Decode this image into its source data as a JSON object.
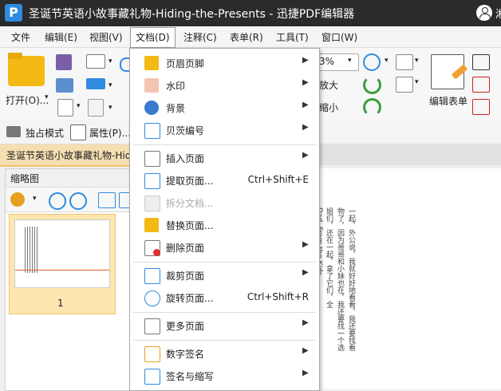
{
  "title_bar": {
    "logo_letter": "P",
    "title": "圣诞节英语小故事藏礼物-Hiding-the-Presents - 迅捷PDF编辑器",
    "user_glyph": "湘"
  },
  "menu": [
    "文件",
    "编辑(E)",
    "视图(V)",
    "文档(D)",
    "注释(C)",
    "表单(R)",
    "工具(T)",
    "窗口(W)"
  ],
  "toolbar": {
    "open_label": "打开(O)...",
    "zoom_value": "3%",
    "zoom_in_label": "放大",
    "zoom_out_label": "缩小",
    "edit_form_label": "编辑表单"
  },
  "modebar": {
    "exclusive_mode": "独占模式",
    "properties": "属性(P)..."
  },
  "doc_tab": {
    "label": "圣诞节英语小故事藏礼物-Hiding-the-Presents"
  },
  "thumbnails": {
    "title": "缩略图",
    "page_number": "1"
  },
  "document_menu": {
    "items": [
      {
        "label": "页眉页脚",
        "shortcut": "",
        "submenu": true,
        "disabled": false
      },
      {
        "label": "水印",
        "shortcut": "",
        "submenu": true,
        "disabled": false
      },
      {
        "label": "背景",
        "shortcut": "",
        "submenu": true,
        "disabled": false
      },
      {
        "label": "贝茨编号",
        "shortcut": "",
        "submenu": true,
        "disabled": false
      },
      {
        "label": "插入页面",
        "shortcut": "",
        "submenu": true,
        "disabled": false
      },
      {
        "label": "提取页面...",
        "shortcut": "Ctrl+Shift+E",
        "submenu": false,
        "disabled": false
      },
      {
        "label": "拆分文档...",
        "shortcut": "",
        "submenu": false,
        "disabled": true
      },
      {
        "label": "替换页面...",
        "shortcut": "",
        "submenu": false,
        "disabled": false
      },
      {
        "label": "删除页面",
        "shortcut": "",
        "submenu": true,
        "disabled": false
      },
      {
        "label": "裁剪页面",
        "shortcut": "",
        "submenu": true,
        "disabled": false
      },
      {
        "label": "旋转页面...",
        "shortcut": "Ctrl+Shift+R",
        "submenu": false,
        "disabled": false
      },
      {
        "label": "更多页面",
        "shortcut": "",
        "submenu": true,
        "disabled": false
      },
      {
        "label": "数字签名",
        "shortcut": "",
        "submenu": true,
        "disabled": false
      },
      {
        "label": "签名与缩写",
        "shortcut": "",
        "submenu": true,
        "disabled": false
      }
    ]
  },
  "document_text": {
    "col1": "Dad. From the Kids",
    "col2": "姐们，还在一起，拿了它们，全",
    "col3": "物了，因为哥哥和小妹也在，我还要找一个选",
    "col4": "一起，外公说，我就好好地看看，我还要找看"
  },
  "colors": {
    "accent": "#2f8be0",
    "titlebar": "#2b2b2b",
    "tab_active": "#f5deb0"
  }
}
